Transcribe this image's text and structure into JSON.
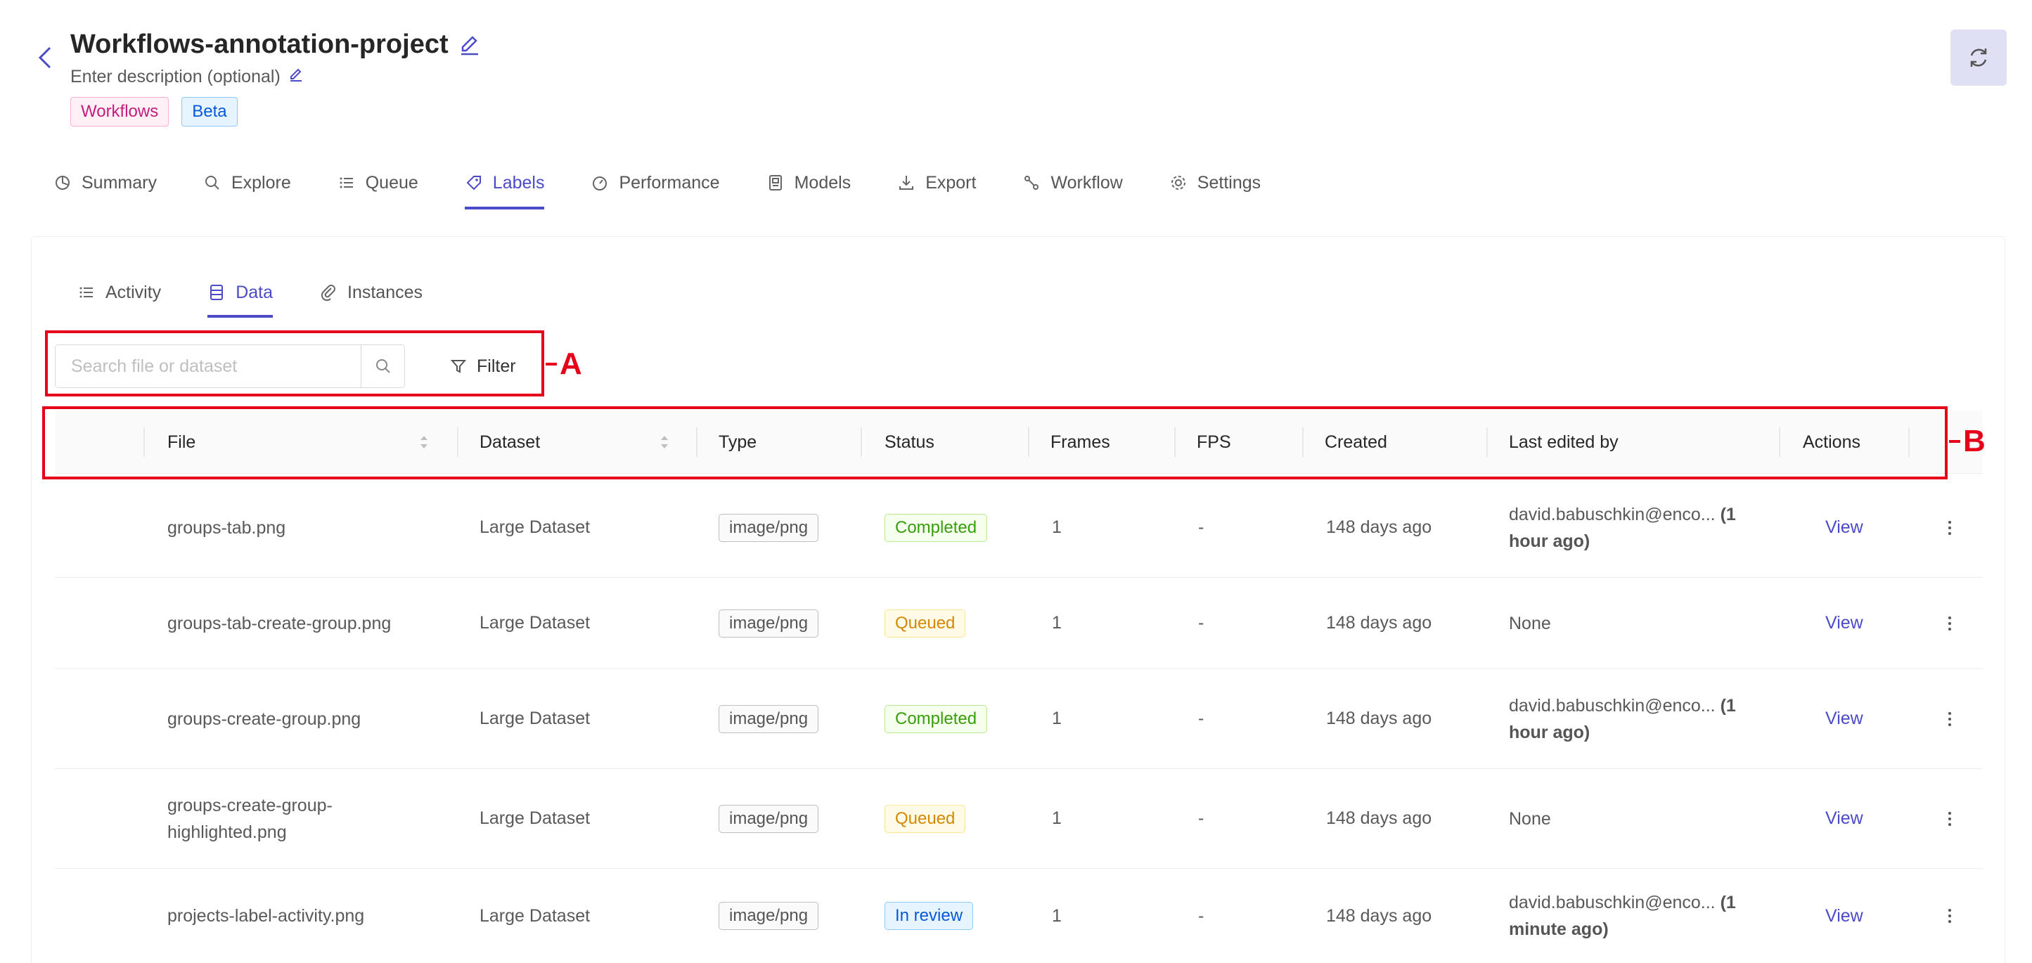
{
  "header": {
    "title": "Workflows-annotation-project",
    "description": "Enter description (optional)",
    "tags": [
      "Workflows",
      "Beta"
    ]
  },
  "main_tabs": [
    {
      "label": "Summary",
      "icon": "pie-chart-icon"
    },
    {
      "label": "Explore",
      "icon": "search-icon"
    },
    {
      "label": "Queue",
      "icon": "list-icon"
    },
    {
      "label": "Labels",
      "icon": "tag-icon",
      "active": true
    },
    {
      "label": "Performance",
      "icon": "dashboard-icon"
    },
    {
      "label": "Models",
      "icon": "model-icon"
    },
    {
      "label": "Export",
      "icon": "download-icon"
    },
    {
      "label": "Workflow",
      "icon": "workflow-icon"
    },
    {
      "label": "Settings",
      "icon": "gear-icon"
    }
  ],
  "sub_tabs": [
    {
      "label": "Activity",
      "icon": "list-icon"
    },
    {
      "label": "Data",
      "icon": "database-icon",
      "active": true
    },
    {
      "label": "Instances",
      "icon": "paperclip-icon"
    }
  ],
  "toolbar": {
    "search_placeholder": "Search file or dataset",
    "filter_label": "Filter"
  },
  "annotations": {
    "a": "A",
    "b": "B"
  },
  "table": {
    "columns": [
      "File",
      "Dataset",
      "Type",
      "Status",
      "Frames",
      "FPS",
      "Created",
      "Last edited by",
      "Actions"
    ],
    "rows": [
      {
        "file": "groups-tab.png",
        "dataset": "Large Dataset",
        "type": "image/png",
        "status": "Completed",
        "frames": "1",
        "fps": "-",
        "created": "148 days ago",
        "editor": "david.babuschkin@enco...",
        "edited": "(1 hour ago)",
        "action": "View"
      },
      {
        "file": "groups-tab-create-group.png",
        "dataset": "Large Dataset",
        "type": "image/png",
        "status": "Queued",
        "frames": "1",
        "fps": "-",
        "created": "148 days ago",
        "editor": "None",
        "edited": "",
        "action": "View"
      },
      {
        "file": "groups-create-group.png",
        "dataset": "Large Dataset",
        "type": "image/png",
        "status": "Completed",
        "frames": "1",
        "fps": "-",
        "created": "148 days ago",
        "editor": "david.babuschkin@enco...",
        "edited": "(1 hour ago)",
        "action": "View"
      },
      {
        "file": "groups-create-group-highlighted.png",
        "dataset": "Large Dataset",
        "type": "image/png",
        "status": "Queued",
        "frames": "1",
        "fps": "-",
        "created": "148 days ago",
        "editor": "None",
        "edited": "",
        "action": "View"
      },
      {
        "file": "projects-label-activity.png",
        "dataset": "Large Dataset",
        "type": "image/png",
        "status": "In review",
        "frames": "1",
        "fps": "-",
        "created": "148 days ago",
        "editor": "david.babuschkin@enco...",
        "edited": "(1 minute ago)",
        "action": "View"
      }
    ]
  },
  "colors": {
    "accent": "#4b4bc8",
    "annotation": "#e6001a"
  }
}
